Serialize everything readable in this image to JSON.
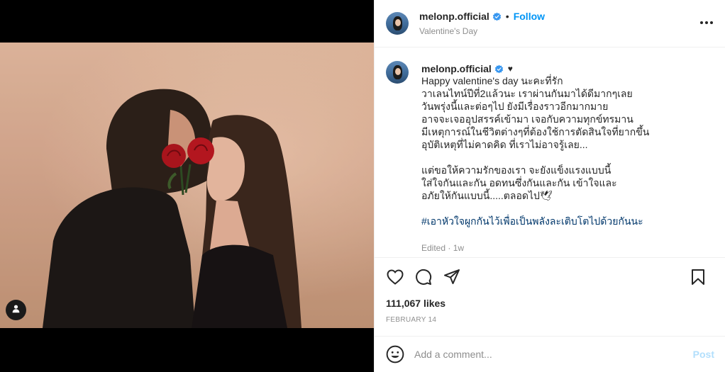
{
  "header": {
    "username": "melonp.official",
    "separator": "•",
    "follow_label": "Follow",
    "location": "Valentine's Day"
  },
  "caption": {
    "username": "melonp.official",
    "heart": "♥",
    "lines": [
      "Happy valentine's day นะคะที่รัก",
      "วาเลนไทน์ปีที่2แล้วนะ เราผ่านกันมาได้ดีมากๆเลย",
      "วันพรุ่งนี้และต่อๆไป ยังมีเรื่องราวอีกมากมาย",
      "อาจจะเจออุปสรรค์เข้ามา เจอกับความทุกข์ทรมาน",
      "มีเหตุการณ์ในชีวิตต่างๆที่ต้องใช้การตัดสินใจที่ยากขึ้น",
      "อุบัติเหตุที่ไม่คาดคิด ที่เราไม่อาจรู้เลย...",
      "แต่ขอให้ความรักของเรา จะยังแข็งแรงแบบนี้",
      "ใส่ใจกันและกัน อดทนซึ่งกันและกัน เข้าใจและ",
      "อภัยให้กันแบบนี้.....ตลอดไป🕊"
    ],
    "hashtag": "#เอาหัวใจผูกกันไว้เพื่อเป็นพลังละเติบโตไปด้วยกันนะ",
    "edited": "Edited · 1w"
  },
  "engagement": {
    "likes": "111,067 likes",
    "date": "FEBRUARY 14"
  },
  "comment": {
    "placeholder": "Add a comment...",
    "post_label": "Post"
  },
  "icons": {
    "more": "more-options-icon",
    "like": "heart-icon",
    "comment": "comment-icon",
    "share": "share-icon",
    "save": "bookmark-icon",
    "emoji": "emoji-icon",
    "user_tag": "user-tag-icon",
    "verified": "verified-badge-icon"
  },
  "colors": {
    "accent": "#0095f6",
    "verified": "#3897f0",
    "hashtag": "#00376b",
    "muted": "#8e8e8e",
    "post_disabled": "#b2dffc"
  }
}
